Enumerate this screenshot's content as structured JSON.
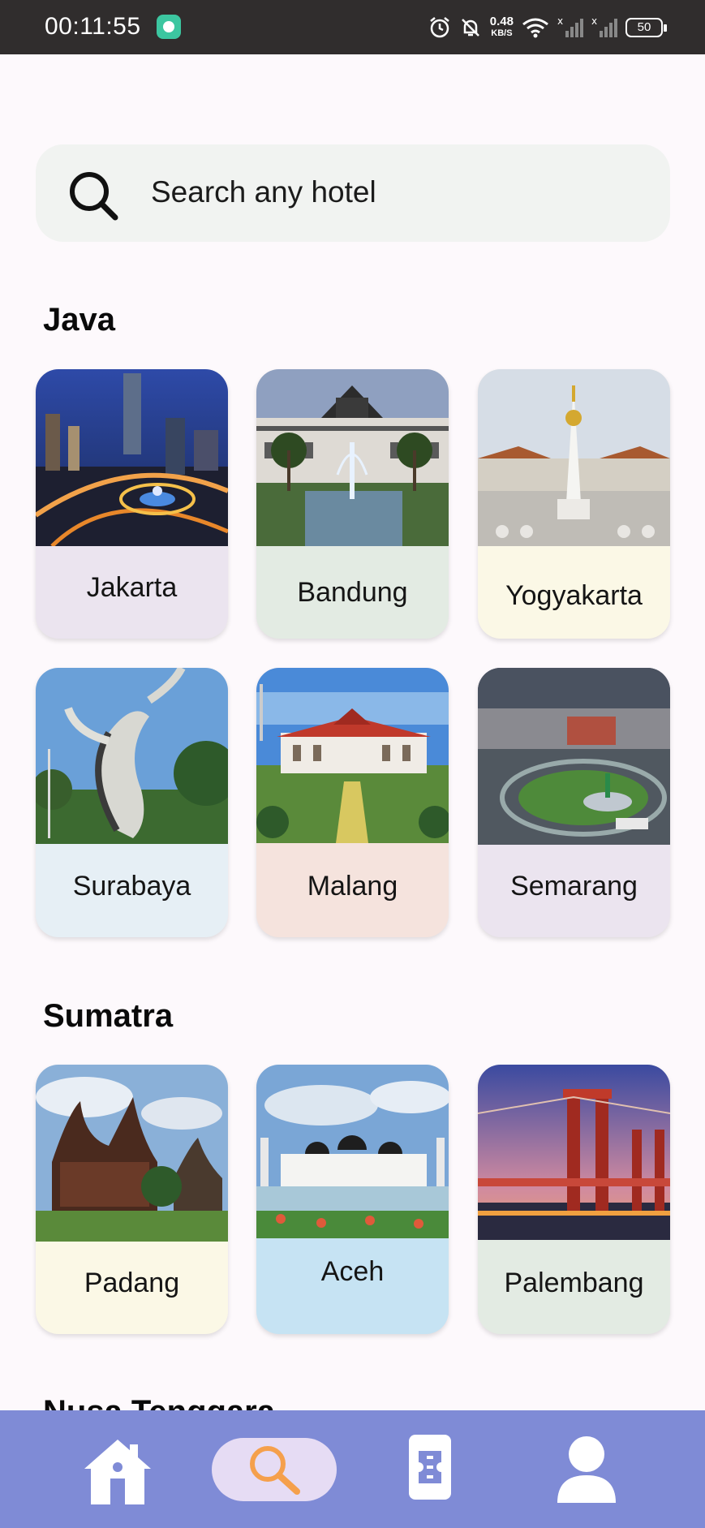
{
  "status_bar": {
    "time": "00:11:55",
    "net_speed_value": "0.48",
    "net_speed_unit": "KB/S",
    "battery": "50"
  },
  "search": {
    "placeholder": "Search any hotel"
  },
  "sections": [
    {
      "title": "Java",
      "cities": [
        "Jakarta",
        "Bandung",
        "Yogyakarta",
        "Surabaya",
        "Malang",
        "Semarang"
      ]
    },
    {
      "title": "Sumatra",
      "cities": [
        "Padang",
        "Aceh",
        "Palembang"
      ]
    },
    {
      "title": "Nusa Tenggara"
    }
  ],
  "card_colors": {
    "jakarta": "#ebe4ef",
    "bandung": "#e3ebe3",
    "yogyakarta": "#fbf8e6",
    "surabaya": "#e6eff5",
    "malang": "#f5e3dd",
    "semarang": "#ebe4ef",
    "padang": "#fbf8e6",
    "aceh": "#c6e3f3",
    "palembang": "#e3ebe3"
  },
  "bottom_nav": {
    "items": [
      "home-icon",
      "search-icon",
      "booking-icon",
      "profile-icon"
    ],
    "active": "search-icon",
    "accent": "#f5a04c",
    "background": "#7f8bd6"
  }
}
